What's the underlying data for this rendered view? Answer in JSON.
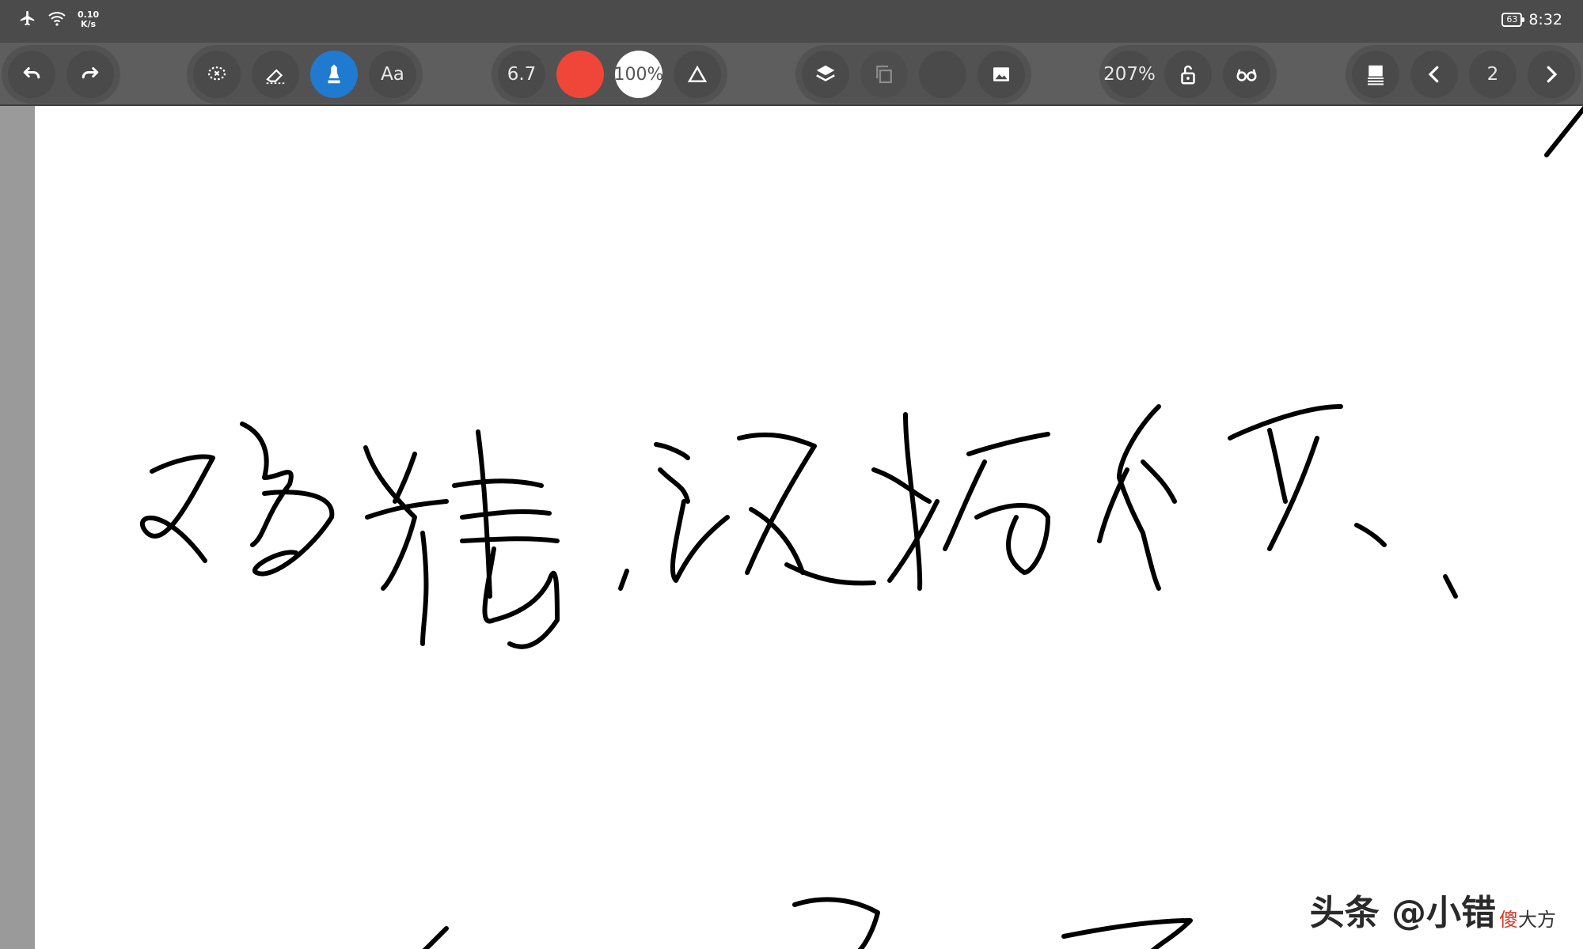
{
  "status": {
    "net_speed_value": "0.10",
    "net_speed_unit": "K/s",
    "battery": "63",
    "time": "8:32"
  },
  "toolbar": {
    "undo_icon": "undo-icon",
    "redo_icon": "redo-icon",
    "lasso_icon": "lasso-icon",
    "eraser_icon": "eraser-icon",
    "pen_icon": "pen-icon",
    "text_label": "Aa",
    "stroke_size": "6.7",
    "color": "#f0463a",
    "opacity": "100%",
    "shape_icon": "triangle-icon",
    "layers_icon": "layers-icon",
    "copy_icon": "copy-icon",
    "image_icon": "image-icon",
    "zoom": "207%",
    "lock_icon": "unlock-icon",
    "read_icon": "glasses-icon",
    "pages_icon": "page-list-icon",
    "prev_icon": "chevron-left-icon",
    "page_number": "2",
    "next_icon": "chevron-right-icon"
  },
  "watermark": {
    "main": "头条 @小错",
    "sub_highlight": "傻",
    "sub_rest": "大方"
  },
  "colors": {
    "active_tool": "#1f7ad0",
    "pen_color": "#f0463a"
  }
}
